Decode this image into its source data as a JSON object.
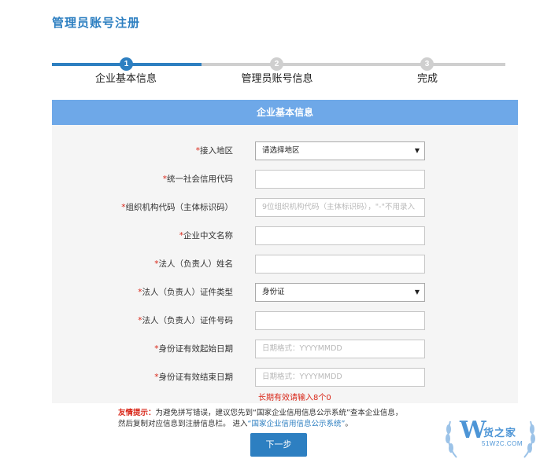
{
  "page": {
    "title": "管理员账号注册"
  },
  "stepper": {
    "steps": [
      {
        "number": "1",
        "label": "企业基本信息",
        "state": "active"
      },
      {
        "number": "2",
        "label": "管理员账号信息",
        "state": "inactive"
      },
      {
        "number": "3",
        "label": "完成",
        "state": "inactive"
      }
    ]
  },
  "form": {
    "header": "企业基本信息",
    "required_mark": "*",
    "fields": [
      {
        "label": "接入地区",
        "type": "select",
        "value": "请选择地区",
        "required": true
      },
      {
        "label": "统一社会信用代码",
        "type": "text",
        "value": "",
        "required": true
      },
      {
        "label": "组织机构代码（主体标识码）",
        "type": "text",
        "placeholder": "9位组织机构代码（主体标识码），\"-\"不用录入",
        "required": true
      },
      {
        "label": "企业中文名称",
        "type": "text",
        "value": "",
        "required": true
      },
      {
        "label": "法人（负责人）姓名",
        "type": "text",
        "value": "",
        "required": true
      },
      {
        "label": "法人（负责人）证件类型",
        "type": "select",
        "value": "身份证",
        "required": true
      },
      {
        "label": "法人（负责人）证件号码",
        "type": "text",
        "value": "",
        "required": true
      },
      {
        "label": "身份证有效起始日期",
        "type": "text",
        "placeholder": "日期格式：YYYYMMDD",
        "required": true
      },
      {
        "label": "身份证有效结束日期",
        "type": "text",
        "placeholder": "日期格式：YYYYMMDD",
        "required": true
      }
    ],
    "long_term_hint": "长期有效请输入8个0"
  },
  "tips": {
    "head": "友情提示：",
    "text1": "为避免拼写错误，建议您先到“国家企业信用信息公示系统”查本企业信息，",
    "text2": "然后复制对应信息到注册信息栏。 进入",
    "link": "“国家企业信用信息公示系统”",
    "end": "。"
  },
  "actions": {
    "next_label": "下一步"
  },
  "watermark": {
    "logo_letter": "W",
    "name": "货之家",
    "url": "51W2C.COM"
  },
  "icons": {
    "select_caret": "▼"
  },
  "colors": {
    "accent": "#2d7fc1",
    "header": "#6ea8e8",
    "required": "#d9281a"
  }
}
